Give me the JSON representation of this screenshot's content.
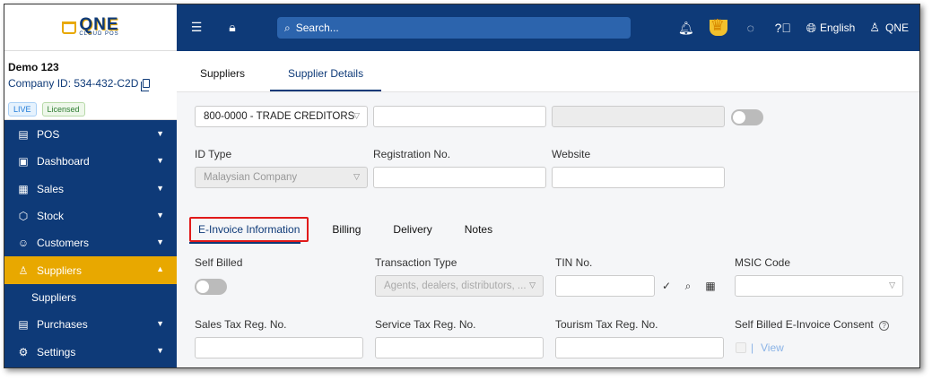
{
  "logo": {
    "brand": "QNE",
    "sub": "CLOUD POS"
  },
  "company": {
    "name": "Demo 123",
    "id_label": "Company ID: 534-432-C2D",
    "badge_live": "LIVE",
    "badge_licensed": "Licensed"
  },
  "nav": {
    "items": [
      {
        "label": "POS",
        "icon": "pos-icon"
      },
      {
        "label": "Dashboard",
        "icon": "dashboard-icon"
      },
      {
        "label": "Sales",
        "icon": "sales-icon"
      },
      {
        "label": "Stock",
        "icon": "stock-icon"
      },
      {
        "label": "Customers",
        "icon": "customers-icon"
      },
      {
        "label": "Suppliers",
        "icon": "suppliers-icon",
        "active": true
      },
      {
        "label": "Purchases",
        "icon": "purchases-icon"
      },
      {
        "label": "Settings",
        "icon": "settings-icon"
      }
    ],
    "sub_item": "Suppliers"
  },
  "topbar": {
    "search_placeholder": "Search...",
    "language": "English",
    "user": "QNE"
  },
  "tabs_top": [
    "Suppliers",
    "Supplier Details"
  ],
  "form": {
    "account_select": "800-0000 - TRADE CREDITORS",
    "id_type_label": "ID Type",
    "id_type_value": "Malaysian Company",
    "reg_label": "Registration No.",
    "website_label": "Website"
  },
  "inner_tabs": [
    "E-Invoice Information",
    "Billing",
    "Delivery",
    "Notes"
  ],
  "einvoice": {
    "self_billed_label": "Self Billed",
    "transaction_type_label": "Transaction Type",
    "transaction_type_placeholder": "Agents, dealers, distributors, ...",
    "tin_label": "TIN No.",
    "msic_label": "MSIC Code",
    "sales_tax_label": "Sales Tax Reg. No.",
    "service_tax_label": "Service Tax Reg. No.",
    "tourism_tax_label": "Tourism Tax Reg. No.",
    "consent_label": "Self Billed E-Invoice Consent",
    "view_link": "View"
  }
}
